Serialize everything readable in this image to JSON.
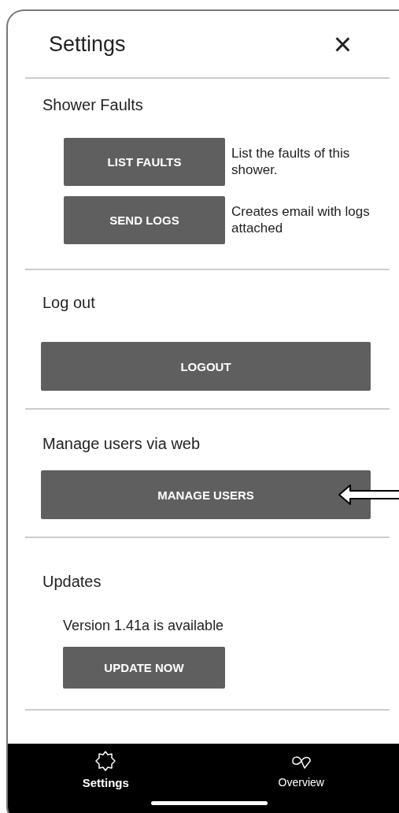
{
  "header": {
    "title": "Settings",
    "close": "×"
  },
  "sections": [
    {
      "heading": "Shower Faults",
      "kind": "described",
      "actions": [
        {
          "label": "LIST FAULTS",
          "description": "List the faults of this shower."
        },
        {
          "label": "SEND LOGS",
          "description": "Creates email with logs attached"
        }
      ]
    },
    {
      "heading": "Log out",
      "kind": "wide",
      "actions": [
        {
          "label": "LOGOUT"
        }
      ]
    },
    {
      "heading": "Manage users via web",
      "kind": "wide",
      "pointer": true,
      "actions": [
        {
          "label": "MANAGE USERS"
        }
      ]
    },
    {
      "heading": "Updates",
      "kind": "update",
      "note": "Version 1.41a is available",
      "actions": [
        {
          "label": "UPDATE NOW"
        }
      ]
    }
  ],
  "nav": [
    {
      "label": "Settings",
      "kind": "gear",
      "selected": true
    },
    {
      "label": "Overview",
      "kind": "loop",
      "selected": false
    }
  ]
}
